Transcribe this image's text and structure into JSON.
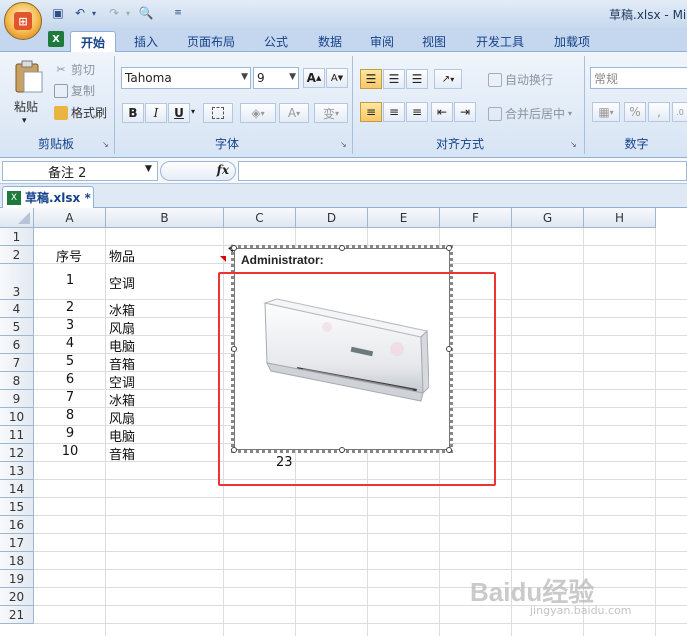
{
  "window": {
    "title": "草稿.xlsx - Mi"
  },
  "quick_access": {
    "save_icon": "save-icon",
    "undo_icon": "undo-icon",
    "redo_icon": "redo-icon",
    "print_preview_icon": "print-preview-icon",
    "customize_icon": "customize-icon"
  },
  "ribbon": {
    "tabs": [
      "开始",
      "插入",
      "页面布局",
      "公式",
      "数据",
      "审阅",
      "视图",
      "开发工具",
      "加载项"
    ],
    "active_tab": "开始",
    "clipboard": {
      "paste_label": "粘贴",
      "cut_label": "剪切",
      "copy_label": "复制",
      "format_painter_label": "格式刷",
      "group_label": "剪贴板"
    },
    "font": {
      "font_name": "Tahoma",
      "font_size": "9",
      "grow_label": "A",
      "shrink_label": "A",
      "bold": "B",
      "italic": "I",
      "underline": "U",
      "fill_label": "A",
      "color_label": "A",
      "phonetic_label": "变",
      "group_label": "字体"
    },
    "alignment": {
      "wrap_label": "自动换行",
      "merge_label": "合并后居中",
      "group_label": "对齐方式"
    },
    "number": {
      "format_value": "常规",
      "percent": "%",
      "comma": ",",
      "group_label": "数字"
    }
  },
  "formula_bar": {
    "name_box": "备注 2",
    "fx": "fx",
    "formula": ""
  },
  "workbook_tab": {
    "label": "草稿.xlsx *"
  },
  "sheet": {
    "columns": [
      "A",
      "B",
      "C",
      "D",
      "E",
      "F",
      "G",
      "H"
    ],
    "rows": [
      "1",
      "2",
      "3",
      "4",
      "5",
      "6",
      "7",
      "8",
      "9",
      "10",
      "11",
      "12",
      "13",
      "14",
      "15",
      "16",
      "17",
      "18",
      "19",
      "20",
      "21"
    ],
    "header_row": {
      "a": "序号",
      "b": "物品"
    },
    "data_rows": [
      {
        "a": "1",
        "b": "空调"
      },
      {
        "a": "2",
        "b": "冰箱"
      },
      {
        "a": "3",
        "b": "风扇"
      },
      {
        "a": "4",
        "b": "电脑"
      },
      {
        "a": "5",
        "b": "音箱"
      },
      {
        "a": "6",
        "b": "空调"
      },
      {
        "a": "7",
        "b": "冰箱"
      },
      {
        "a": "8",
        "b": "风扇"
      },
      {
        "a": "9",
        "b": "电脑"
      },
      {
        "a": "10",
        "b": "音箱"
      }
    ],
    "c12_value": "23"
  },
  "comment": {
    "author": "Administrator:",
    "image": "air-conditioner-image"
  },
  "watermark": {
    "main": "Baidu经验",
    "sub": "jingyan.baidu.com"
  },
  "colors": {
    "accent": "#15428b",
    "ribbon_bg": "#d7e4f4",
    "highlight": "#e33333",
    "grid_line": "#dadcdd"
  }
}
